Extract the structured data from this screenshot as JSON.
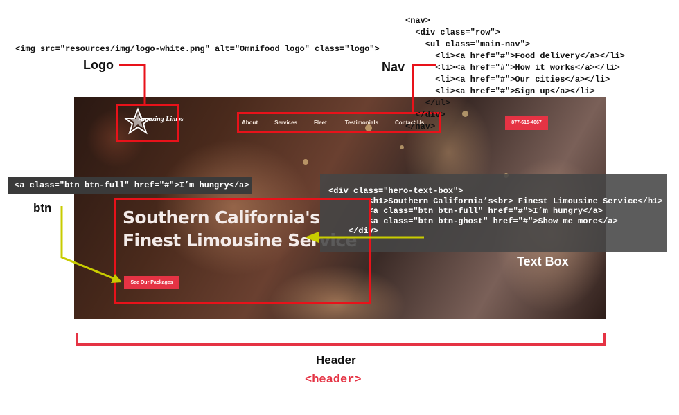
{
  "labels": {
    "logo": "Logo",
    "nav": "Nav",
    "btn": "btn",
    "text_box": "Text Box",
    "header": "Header",
    "header_tag": "<header>"
  },
  "code": {
    "img": "<img src=\"resources/img/logo-white.png\" alt=\"Omnifood logo\" class=\"logo\">",
    "nav": [
      "<nav>",
      "  <div class=\"row\">",
      "    <ul class=\"main-nav\">",
      "      <li><a href=\"#\">Food delivery</a></li>",
      "      <li><a href=\"#\">How it works</a></li>",
      "      <li><a href=\"#\">Our cities</a></li>",
      "      <li><a href=\"#\">Sign up</a></li>",
      "    </ul>",
      "  </div>",
      "</nav>"
    ],
    "btn": "<a class=\"btn btn-full\" href=\"#\">I’m hungry</a>",
    "text_box": [
      "<div class=\"hero-text-box\">",
      "        <h1>Southern California’s<br> Finest Limousine Service</h1>",
      "        <a class=\"btn btn-full\" href=\"#\">I’m hungry</a>",
      "        <a class=\"btn btn-ghost\" href=\"#\">Show me more</a>",
      "    </div>"
    ]
  },
  "hero": {
    "logo_text": "Amazing Limos",
    "nav_links": [
      "About",
      "Services",
      "Fleet",
      "Testimonials",
      "Contact Us"
    ],
    "phone": "877-615-4667",
    "h1_line1": "Southern California's",
    "h1_line2": "Finest Limousine Service",
    "button": "See Our Packages"
  },
  "colors": {
    "accent_red": "#e8121a",
    "brand_red": "#e53344",
    "arrow_yellow": "#c8cc00",
    "code_box": "#3a3a3a"
  }
}
